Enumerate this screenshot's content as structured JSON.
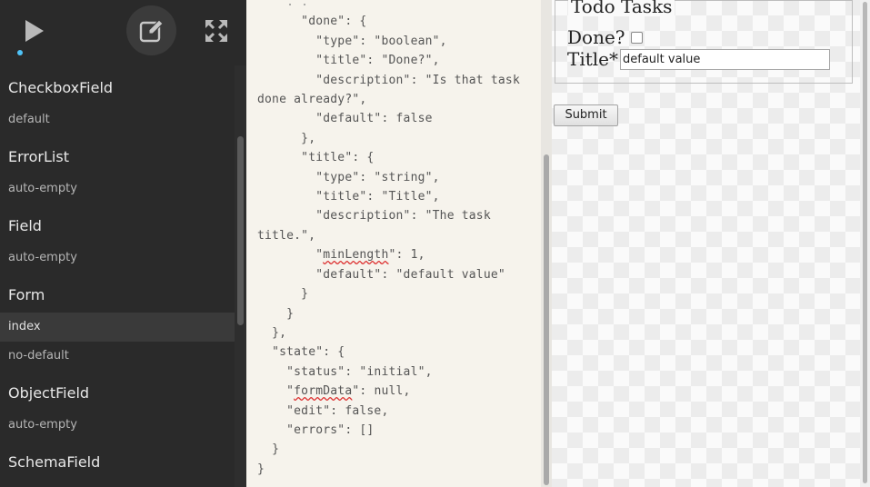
{
  "toolbar": {
    "play_icon": "play-icon",
    "edit_icon": "edit-icon",
    "expand_icon": "expand-icon",
    "accent": "#4fc3f7"
  },
  "components": [
    {
      "name": "CheckboxField",
      "variants": [
        "default"
      ]
    },
    {
      "name": "ErrorList",
      "variants": [
        "auto-empty"
      ]
    },
    {
      "name": "Field",
      "variants": [
        "auto-empty"
      ]
    },
    {
      "name": "Form",
      "variants": [
        "index",
        "no-default"
      ]
    },
    {
      "name": "ObjectField",
      "variants": [
        "auto-empty"
      ]
    },
    {
      "name": "SchemaField",
      "variants": []
    }
  ],
  "active_variant": "Form/index",
  "editor": {
    "lines": [
      "      \"done\": {",
      "        \"type\": \"boolean\",",
      "        \"title\": \"Done?\",",
      "        \"description\": \"Is that task done already?\",",
      "        \"default\": false",
      "      },",
      "      \"title\": {",
      "        \"type\": \"string\",",
      "        \"title\": \"Title\",",
      "        \"description\": \"The task title.\",",
      "        \"minLength\": 1,",
      "        \"default\": \"default value\"",
      "      }",
      "    }",
      "  },",
      "  \"state\": {",
      "    \"status\": \"initial\",",
      "    \"formData\": null,",
      "    \"edit\": false,",
      "    \"errors\": []",
      "  }",
      "}"
    ]
  },
  "preview": {
    "legend": "Todo Tasks",
    "done_label": "Done?",
    "title_label": "Title*",
    "title_value": "default value",
    "submit_label": "Submit"
  }
}
